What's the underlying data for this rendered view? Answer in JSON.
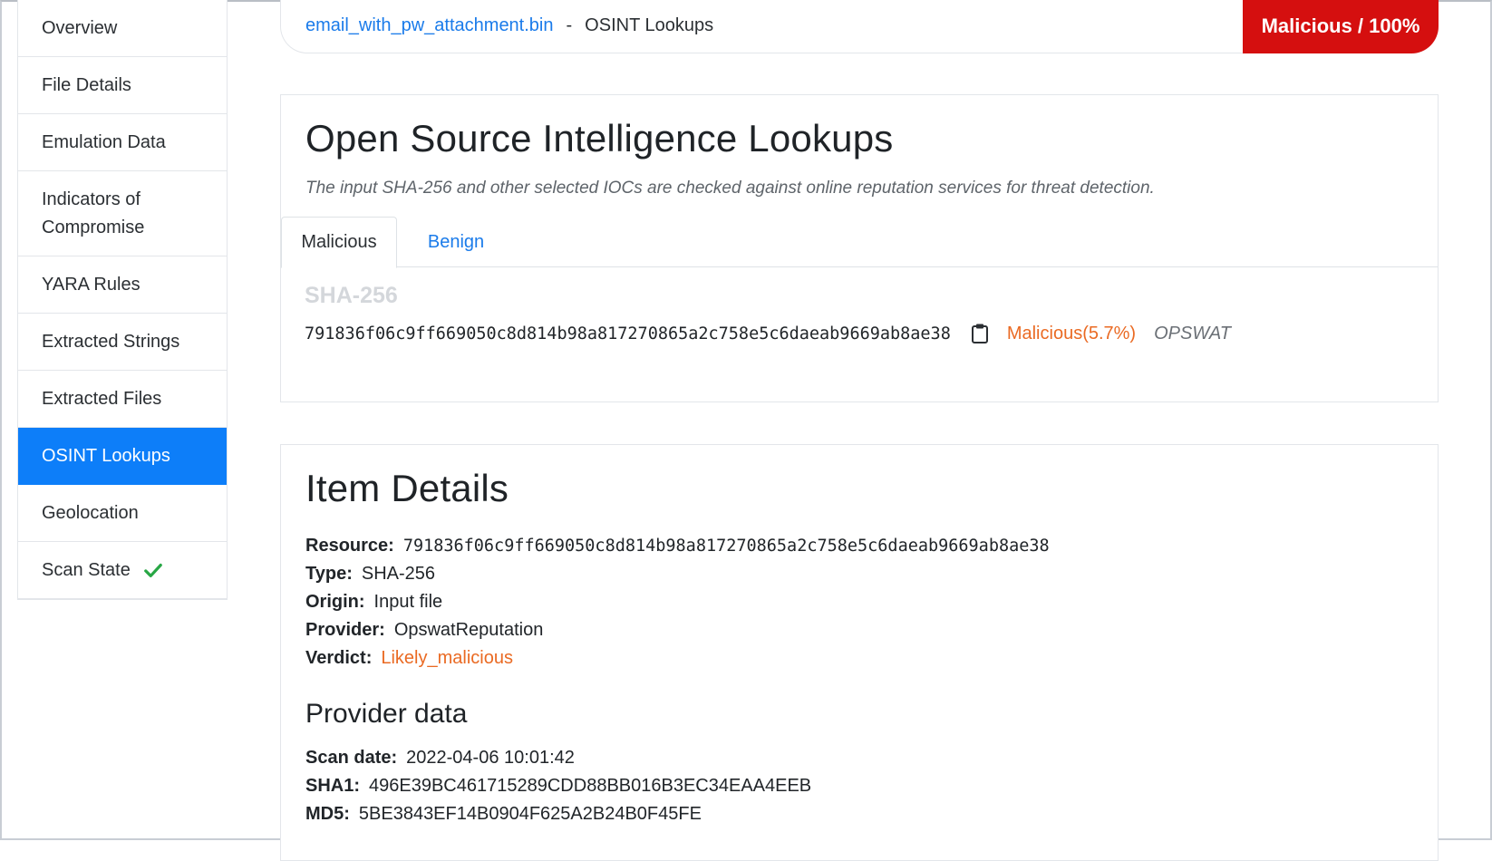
{
  "sidebar": {
    "items": [
      {
        "label": "Overview"
      },
      {
        "label": "File Details"
      },
      {
        "label": "Emulation Data"
      },
      {
        "label": "Indicators of Compromise"
      },
      {
        "label": "YARA Rules"
      },
      {
        "label": "Extracted Strings"
      },
      {
        "label": "Extracted Files"
      },
      {
        "label": "OSINT Lookups",
        "active": true
      },
      {
        "label": "Geolocation"
      },
      {
        "label": "Scan State",
        "icon": "checkmark-icon"
      }
    ]
  },
  "header": {
    "file_link": "email_with_pw_attachment.bin",
    "separator": "-",
    "section": "OSINT Lookups",
    "verdict": "Malicious / 100%",
    "verdict_color": "#d50f0f"
  },
  "osint": {
    "title": "Open Source Intelligence Lookups",
    "subtitle": "The input SHA-256 and other selected IOCs are checked against online reputation services for threat detection.",
    "tabs": [
      {
        "label": "Malicious",
        "active": true
      },
      {
        "label": "Benign",
        "active": false
      }
    ],
    "hash_type": "SHA-256",
    "hash_value": "791836f06c9ff669050c8d814b98a817270865a2c758e5c6daeab9669ab8ae38",
    "copy_icon": "clipboard-icon",
    "result_verdict": "Malicious(5.7%)",
    "result_provider": "OPSWAT",
    "accent_orange": "#ea6a23"
  },
  "item_details": {
    "title": "Item Details",
    "rows": [
      {
        "label": "Resource:",
        "value": "791836f06c9ff669050c8d814b98a817270865a2c758e5c6daeab9669ab8ae38"
      },
      {
        "label": "Type:",
        "value": "SHA-256"
      },
      {
        "label": "Origin:",
        "value": "Input file"
      },
      {
        "label": "Provider:",
        "value": "OpswatReputation"
      },
      {
        "label": "Verdict:",
        "value": "Likely_malicious"
      }
    ],
    "provider_title": "Provider data",
    "provider_rows": [
      {
        "label": "Scan date:",
        "value": "2022-04-06 10:01:42"
      },
      {
        "label": "SHA1:",
        "value": "496E39BC461715289CDD88BB016B3EC34EAA4EEB"
      },
      {
        "label": "MD5:",
        "value": "5BE3843EF14B0904F625A2B24B0F45FE"
      }
    ]
  }
}
